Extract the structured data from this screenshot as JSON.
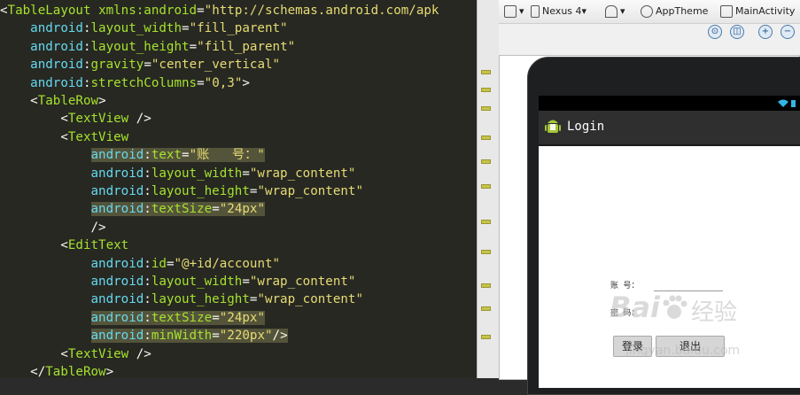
{
  "editor": {
    "lines": [
      {
        "parts": [
          [
            "pun",
            "<"
          ],
          [
            "tag",
            "TableLayout"
          ],
          [
            "pun",
            " "
          ],
          [
            "attr",
            "xmlns:android"
          ],
          [
            "pun",
            "="
          ],
          [
            "str",
            "\"http://schemas.android.com/apk"
          ]
        ]
      },
      {
        "parts": [
          [
            "pun",
            "    "
          ],
          [
            "ns",
            "android"
          ],
          [
            "pun",
            ":"
          ],
          [
            "attr",
            "layout_width"
          ],
          [
            "pun",
            "="
          ],
          [
            "str",
            "\"fill_parent\""
          ]
        ]
      },
      {
        "parts": [
          [
            "pun",
            "    "
          ],
          [
            "ns",
            "android"
          ],
          [
            "pun",
            ":"
          ],
          [
            "attr",
            "layout_height"
          ],
          [
            "pun",
            "="
          ],
          [
            "str",
            "\"fill_parent\""
          ]
        ]
      },
      {
        "parts": [
          [
            "pun",
            "    "
          ],
          [
            "ns",
            "android"
          ],
          [
            "pun",
            ":"
          ],
          [
            "attr",
            "gravity"
          ],
          [
            "pun",
            "="
          ],
          [
            "str",
            "\"center_vertical\""
          ]
        ]
      },
      {
        "parts": [
          [
            "pun",
            "    "
          ],
          [
            "ns",
            "android"
          ],
          [
            "pun",
            ":"
          ],
          [
            "attr",
            "stretchColumns"
          ],
          [
            "pun",
            "="
          ],
          [
            "str",
            "\"0,3\""
          ],
          [
            "pun",
            ">"
          ]
        ]
      },
      {
        "parts": [
          [
            "pun",
            "    <"
          ],
          [
            "tag",
            "TableRow"
          ],
          [
            "pun",
            ">"
          ]
        ]
      },
      {
        "parts": [
          [
            "pun",
            "        <"
          ],
          [
            "tag",
            "TextView"
          ],
          [
            "pun",
            " />"
          ]
        ]
      },
      {
        "parts": [
          [
            "pun",
            "        <"
          ],
          [
            "tag",
            "TextView"
          ]
        ]
      },
      {
        "hl": true,
        "parts": [
          [
            "pun",
            "            "
          ],
          [
            "ns",
            "android"
          ],
          [
            "pun",
            ":"
          ],
          [
            "attr",
            "text"
          ],
          [
            "pun",
            "="
          ],
          [
            "str",
            "\"账   号：\""
          ]
        ]
      },
      {
        "parts": [
          [
            "pun",
            "            "
          ],
          [
            "ns",
            "android"
          ],
          [
            "pun",
            ":"
          ],
          [
            "attr",
            "layout_width"
          ],
          [
            "pun",
            "="
          ],
          [
            "str",
            "\"wrap_content\""
          ]
        ]
      },
      {
        "parts": [
          [
            "pun",
            "            "
          ],
          [
            "ns",
            "android"
          ],
          [
            "pun",
            ":"
          ],
          [
            "attr",
            "layout_height"
          ],
          [
            "pun",
            "="
          ],
          [
            "str",
            "\"wrap_content\""
          ]
        ]
      },
      {
        "hl": true,
        "parts": [
          [
            "pun",
            "            "
          ],
          [
            "ns",
            "android"
          ],
          [
            "pun",
            ":"
          ],
          [
            "attr",
            "textSize"
          ],
          [
            "pun",
            "="
          ],
          [
            "str",
            "\"24px\""
          ]
        ]
      },
      {
        "parts": [
          [
            "pun",
            "            />"
          ]
        ]
      },
      {
        "parts": [
          [
            "pun",
            "        <"
          ],
          [
            "tag",
            "EditText"
          ]
        ]
      },
      {
        "parts": [
          [
            "pun",
            "            "
          ],
          [
            "ns",
            "android"
          ],
          [
            "pun",
            ":"
          ],
          [
            "attr",
            "id"
          ],
          [
            "pun",
            "="
          ],
          [
            "str",
            "\"@+id/account\""
          ]
        ]
      },
      {
        "parts": [
          [
            "pun",
            "            "
          ],
          [
            "ns",
            "android"
          ],
          [
            "pun",
            ":"
          ],
          [
            "attr",
            "layout_width"
          ],
          [
            "pun",
            "="
          ],
          [
            "str",
            "\"wrap_content\""
          ]
        ]
      },
      {
        "parts": [
          [
            "pun",
            "            "
          ],
          [
            "ns",
            "android"
          ],
          [
            "pun",
            ":"
          ],
          [
            "attr",
            "layout_height"
          ],
          [
            "pun",
            "="
          ],
          [
            "str",
            "\"wrap_content\""
          ]
        ]
      },
      {
        "hl": true,
        "parts": [
          [
            "pun",
            "            "
          ],
          [
            "ns",
            "android"
          ],
          [
            "pun",
            ":"
          ],
          [
            "attr",
            "textSize"
          ],
          [
            "pun",
            "="
          ],
          [
            "str",
            "\"24px\""
          ]
        ]
      },
      {
        "hl": true,
        "parts": [
          [
            "pun",
            "            "
          ],
          [
            "ns",
            "android"
          ],
          [
            "pun",
            ":"
          ],
          [
            "attr",
            "minWidth"
          ],
          [
            "pun",
            "="
          ],
          [
            "str",
            "\"220px\""
          ],
          [
            "pun",
            "/>"
          ]
        ]
      },
      {
        "parts": [
          [
            "pun",
            "        <"
          ],
          [
            "tag",
            "TextView"
          ],
          [
            "pun",
            " />"
          ]
        ]
      },
      {
        "parts": [
          [
            "pun",
            "    </"
          ],
          [
            "tag",
            "TableRow"
          ],
          [
            "pun",
            ">"
          ]
        ]
      }
    ]
  },
  "toolbar": {
    "device": "Nexus 4",
    "theme": "AppTheme",
    "activity": "MainActivity"
  },
  "app": {
    "title": "Login",
    "account_label": "账  号：",
    "password_label": "密  码：",
    "login_button": "登录",
    "exit_button": "退出"
  },
  "watermark": {
    "brand": "Bai",
    "brand_cn": "经验",
    "site": "jingyan.baidu.com"
  },
  "colors": {
    "editor_bg": "#272822",
    "tag": "#a6e22e",
    "string": "#e6db74",
    "namespace": "#66d9ef",
    "highlight": "#54543a"
  }
}
